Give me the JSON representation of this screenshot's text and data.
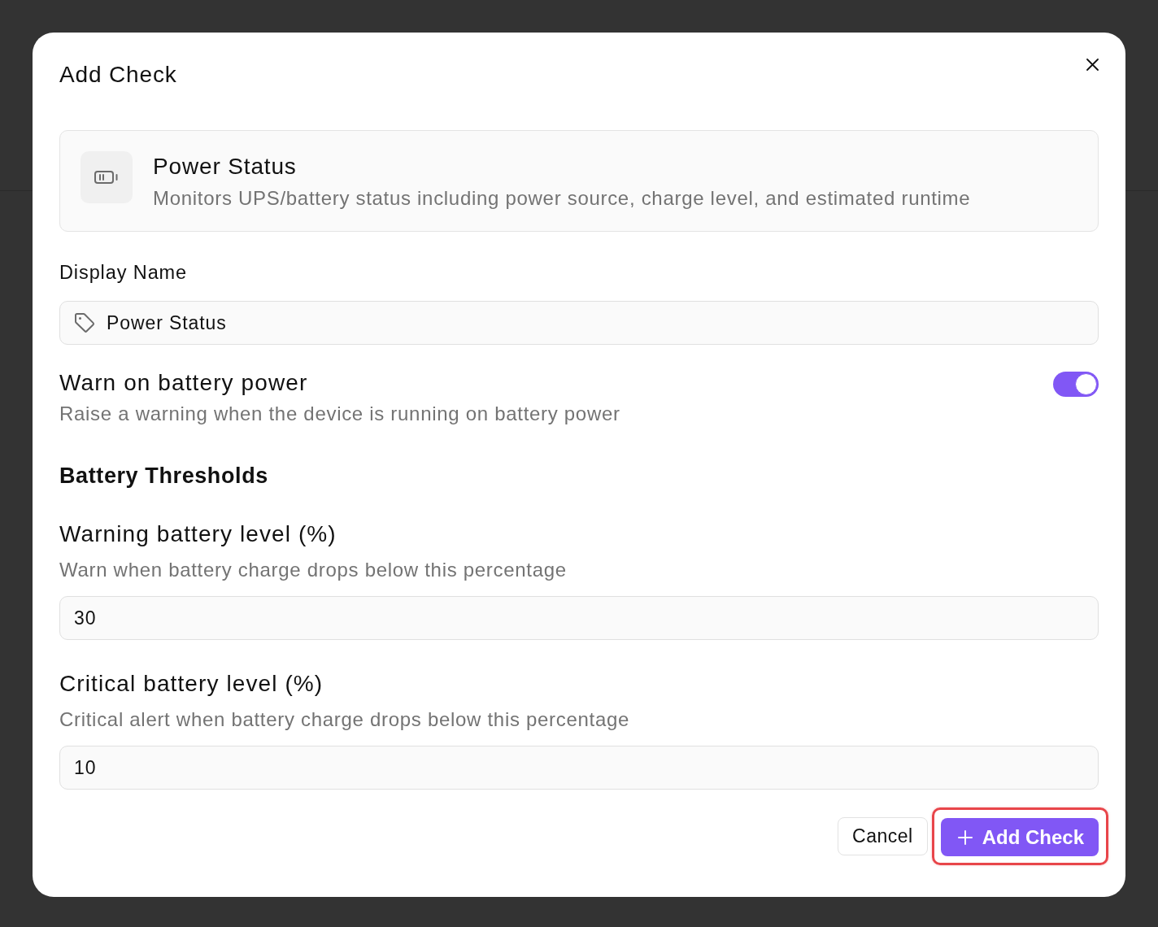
{
  "dialog": {
    "title": "Add Check"
  },
  "check_type": {
    "title": "Power Status",
    "description": "Monitors UPS/battery status including power source, charge level, and estimated runtime"
  },
  "display_name": {
    "label": "Display Name",
    "value": "Power Status"
  },
  "warn_on_battery": {
    "label": "Warn on battery power",
    "description": "Raise a warning when the device is running on battery power",
    "on": true
  },
  "section_title": "Battery Thresholds",
  "thresholds": [
    {
      "label": "Warning battery level (%)",
      "description": "Warn when battery charge drops below this percentage",
      "value": "30"
    },
    {
      "label": "Critical battery level (%)",
      "description": "Critical alert when battery charge drops below this percentage",
      "value": "10"
    }
  ],
  "buttons": [
    {
      "label": "Cancel",
      "kind": "secondary",
      "highlighted": false
    },
    {
      "label": "Add Check",
      "kind": "primary",
      "highlighted": true
    }
  ]
}
